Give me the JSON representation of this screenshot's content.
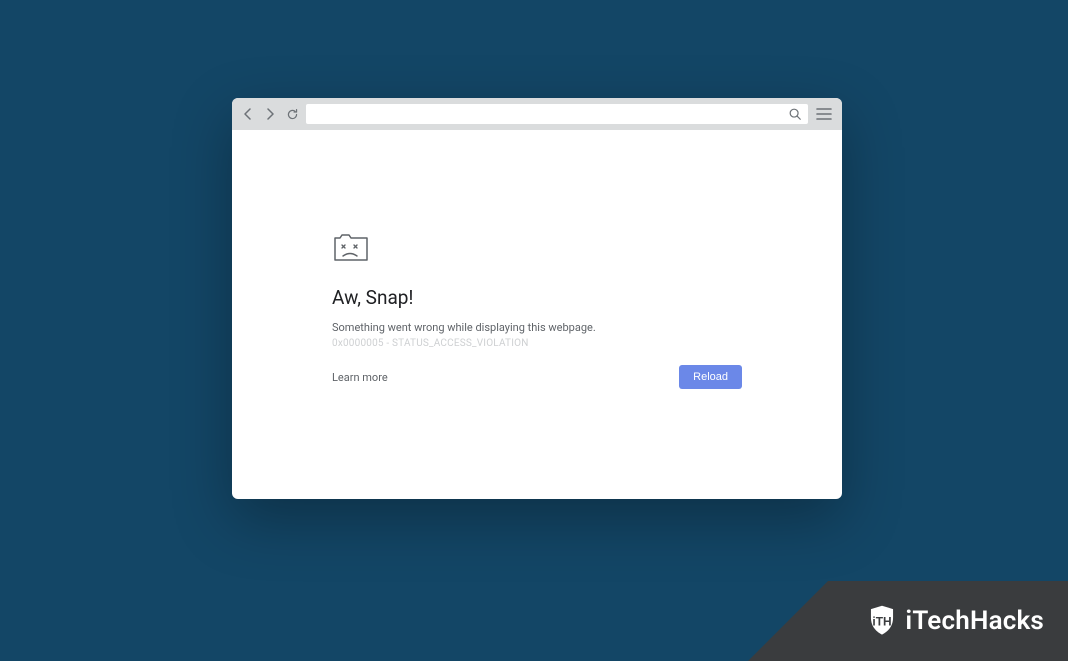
{
  "toolbar": {
    "url_value": ""
  },
  "error": {
    "title": "Aw, Snap!",
    "message": "Something went wrong while displaying this webpage.",
    "code": "0x0000005 - STATUS_ACCESS_VIOLATION",
    "learn_more_label": "Learn more",
    "reload_label": "Reload"
  },
  "watermark": {
    "text": "iTechHacks"
  }
}
